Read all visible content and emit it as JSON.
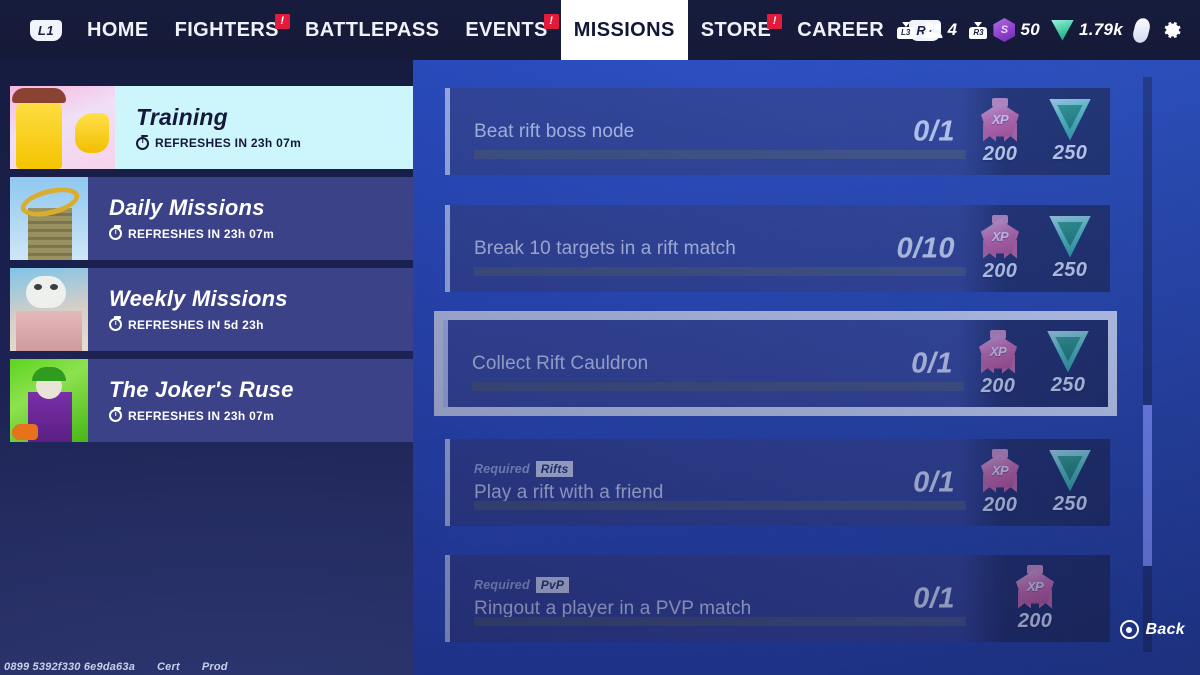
{
  "nav": {
    "left_bumper": "L1",
    "right_bumper": "R1",
    "items": [
      {
        "label": "HOME",
        "badge": "",
        "active": false
      },
      {
        "label": "FIGHTERS",
        "badge": "!",
        "active": false
      },
      {
        "label": "BATTLEPASS",
        "badge": "",
        "active": false
      },
      {
        "label": "EVENTS",
        "badge": "!",
        "active": false
      },
      {
        "label": "MISSIONS",
        "badge": "",
        "active": true
      },
      {
        "label": "STORE",
        "badge": "!",
        "active": false
      },
      {
        "label": "CAREER",
        "badge": "",
        "active": false
      }
    ]
  },
  "hud": {
    "left_stick_label": "L3",
    "right_stick_label": "R3",
    "friends_count": "4",
    "gem_symbol": "S",
    "gem_amount": "50",
    "token_amount": "1.79k"
  },
  "sidebar": {
    "items": [
      {
        "title": "Training",
        "refresh": "REFRESHES IN 23h 07m",
        "selected": true,
        "thumb": "th-training"
      },
      {
        "title": "Daily Missions",
        "refresh": "REFRESHES IN 23h 07m",
        "selected": false,
        "thumb": "th-daily"
      },
      {
        "title": "Weekly Missions",
        "refresh": "REFRESHES IN 5d 23h",
        "selected": false,
        "thumb": "th-weekly"
      },
      {
        "title": "The Joker's Ruse",
        "refresh": "REFRESHES IN 23h 07m",
        "selected": false,
        "thumb": "th-joker"
      }
    ]
  },
  "missions": [
    {
      "title": "Beat rift boss node",
      "count": "0/1",
      "progress_pct": 0,
      "required": "",
      "mode_chip": "",
      "highlighted": false,
      "rewards": [
        {
          "type": "xp",
          "label": "XP",
          "amount": "200"
        },
        {
          "type": "token",
          "label": "",
          "amount": "250"
        }
      ]
    },
    {
      "title": "Break 10 targets in a rift match",
      "count": "0/10",
      "progress_pct": 0,
      "required": "",
      "mode_chip": "",
      "highlighted": false,
      "rewards": [
        {
          "type": "xp",
          "label": "XP",
          "amount": "200"
        },
        {
          "type": "token",
          "label": "",
          "amount": "250"
        }
      ]
    },
    {
      "title": "Collect Rift Cauldron",
      "count": "0/1",
      "progress_pct": 0,
      "required": "",
      "mode_chip": "",
      "highlighted": true,
      "rewards": [
        {
          "type": "xp",
          "label": "XP",
          "amount": "200"
        },
        {
          "type": "token",
          "label": "",
          "amount": "250"
        }
      ]
    },
    {
      "title": "Play a rift with a friend",
      "count": "0/1",
      "progress_pct": 0,
      "required": "Required",
      "mode_chip": "Rifts",
      "highlighted": false,
      "rewards": [
        {
          "type": "xp",
          "label": "XP",
          "amount": "200"
        },
        {
          "type": "token",
          "label": "",
          "amount": "250"
        }
      ]
    },
    {
      "title": "Ringout a player in a PVP match",
      "count": "0/1",
      "progress_pct": 0,
      "required": "Required",
      "mode_chip": "PvP",
      "highlighted": false,
      "rewards": [
        {
          "type": "xp",
          "label": "XP",
          "amount": "200"
        }
      ]
    }
  ],
  "scrollbar": {
    "thumb_top_pct": 57,
    "thumb_height_pct": 28
  },
  "footer": {
    "back_label": "Back",
    "build_id": "0899 5392f330 6e9da63a",
    "env_cert": "Cert",
    "env_prod": "Prod"
  },
  "colors": {
    "accent_blue": "#2748c4",
    "selected_cyan": "#ccf6fb",
    "badge_red": "#e21b3c",
    "xp_pink": "#f2709f",
    "token_teal": "#5fd9b4",
    "gem_purple": "#8c3fc9"
  }
}
